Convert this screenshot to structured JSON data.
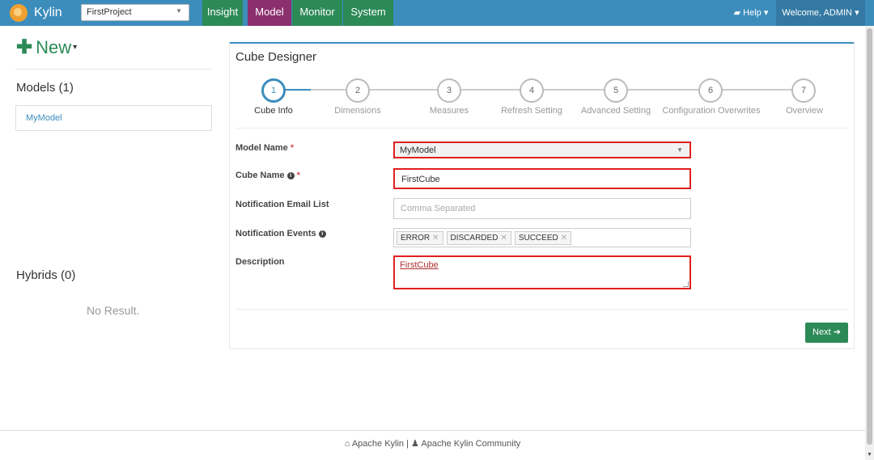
{
  "brand": {
    "name": "Kylin"
  },
  "project_select": {
    "value": "FirstProject"
  },
  "nav": {
    "tabs": [
      "Insight",
      "Model",
      "Monitor",
      "System"
    ],
    "active": "Model"
  },
  "right_nav": {
    "help": "Help",
    "welcome": "Welcome, ADMIN"
  },
  "sidebar": {
    "new_label": "New",
    "models_title": "Models (1)",
    "models": [
      "MyModel"
    ],
    "hybrids_title": "Hybrids (0)",
    "no_result": "No Result."
  },
  "designer": {
    "title": "Cube Designer",
    "steps": [
      {
        "num": "1",
        "label": "Cube Info"
      },
      {
        "num": "2",
        "label": "Dimensions"
      },
      {
        "num": "3",
        "label": "Measures"
      },
      {
        "num": "4",
        "label": "Refresh Setting"
      },
      {
        "num": "5",
        "label": "Advanced Setting"
      },
      {
        "num": "6",
        "label": "Configuration Overwrites"
      },
      {
        "num": "7",
        "label": "Overview"
      }
    ],
    "active_step": 1
  },
  "form": {
    "model_name_label": "Model Name",
    "model_name_value": "MyModel",
    "cube_name_label": "Cube Name",
    "cube_name_value": "FirstCube",
    "email_label": "Notification Email List",
    "email_placeholder": "Comma Separated",
    "events_label": "Notification Events",
    "events": [
      "ERROR",
      "DISCARDED",
      "SUCCEED"
    ],
    "description_label": "Description",
    "description_value": "FirstCube",
    "required_mark": "*"
  },
  "next_button": "Next",
  "footer": {
    "link1": "Apache Kylin",
    "separator": "|",
    "link2": "Apache Kylin Community"
  },
  "colors": {
    "topbar": "#3c8dbc",
    "active_tab": "#8b2f6e",
    "tab": "#2c8a57",
    "highlight": "#e02020"
  }
}
